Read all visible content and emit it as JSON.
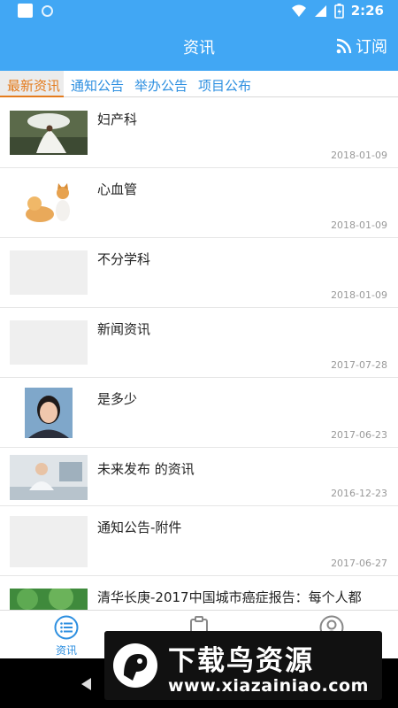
{
  "status_bar": {
    "time": "2:26"
  },
  "app_bar": {
    "title": "资讯",
    "subscribe_label": "订阅"
  },
  "tabs": [
    {
      "label": "最新资讯",
      "active": true
    },
    {
      "label": "通知公告",
      "active": false
    },
    {
      "label": "举办公告",
      "active": false
    },
    {
      "label": "项目公布",
      "active": false
    }
  ],
  "news": [
    {
      "title": "妇产科",
      "date": "2018-01-09",
      "thumb": "woman-with-umbrella-photo"
    },
    {
      "title": "心血管",
      "date": "2018-01-09",
      "thumb": "dog-and-cat-photo"
    },
    {
      "title": "不分学科",
      "date": "2018-01-09",
      "thumb": "placeholder"
    },
    {
      "title": "新闻资讯",
      "date": "2017-07-28",
      "thumb": "placeholder"
    },
    {
      "title": "是多少",
      "date": "2017-06-23",
      "thumb": "woman-portrait-photo"
    },
    {
      "title": "未来发布 的资讯",
      "date": "2016-12-23",
      "thumb": "doctor-at-desk-photo"
    },
    {
      "title": "通知公告-附件",
      "date": "2017-06-27",
      "thumb": "placeholder"
    },
    {
      "title": "清华长庚-2017中国城市癌症报告：每个人都",
      "date": "",
      "thumb": "trees-photo"
    }
  ],
  "bottom_nav": {
    "news_label": "资讯"
  },
  "watermark": {
    "title": "下载鸟资源",
    "url": "www.xiazainiao.com"
  },
  "colors": {
    "primary": "#41a7f4",
    "active_tab": "#e47b1d",
    "tab_text": "#2d8fe0"
  }
}
